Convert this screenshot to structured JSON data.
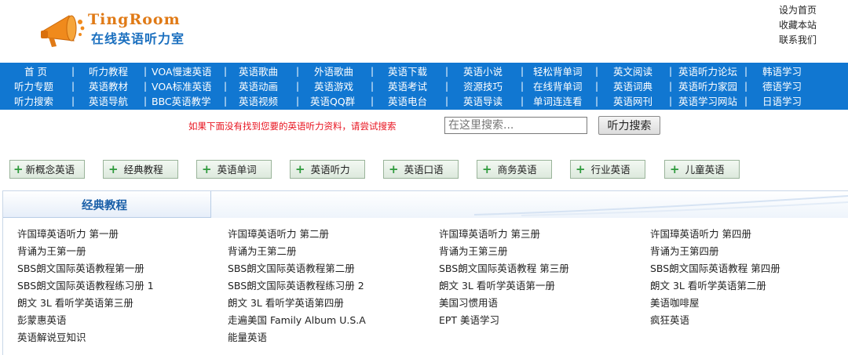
{
  "site": {
    "brand_en": "TingRoom",
    "brand_cn": "在线英语听力室",
    "top_links": [
      "设为首页",
      "收藏本站",
      "联系我们"
    ]
  },
  "nav": {
    "rows": [
      [
        "首 页",
        "听力教程",
        "VOA慢速英语",
        "英语歌曲",
        "外语歌曲",
        "英语下载",
        "英语小说",
        "轻松背单词",
        "英文阅读",
        "英语听力论坛",
        "韩语学习"
      ],
      [
        "听力专题",
        "英语教材",
        "VOA标准英语",
        "英语动画",
        "英语游戏",
        "英语考试",
        "资源技巧",
        "在线背单词",
        "英语词典",
        "英语听力家园",
        "德语学习"
      ],
      [
        "听力搜索",
        "英语导航",
        "BBC英语教学",
        "英语视频",
        "英语QQ群",
        "英语电台",
        "英语导读",
        "单词连连看",
        "英语网刊",
        "英语学习网站",
        "日语学习"
      ]
    ]
  },
  "search": {
    "hint": "如果下面没有找到您要的英语听力资料，请尝试搜索",
    "placeholder": "在这里搜索...",
    "button": "听力搜索"
  },
  "categories": [
    "新概念英语",
    "经典教程",
    "英语单词",
    "英语听力",
    "英语口语",
    "商务英语",
    "行业英语",
    "儿童英语"
  ],
  "panel": {
    "title": "经典教程",
    "courses": [
      [
        "许国璋英语听力 第一册",
        "许国璋英语听力 第二册",
        "许国璋英语听力 第三册",
        "许国璋英语听力 第四册"
      ],
      [
        "背诵为王第一册",
        "背诵为王第二册",
        "背诵为王第三册",
        "背诵为王第四册"
      ],
      [
        "SBS朗文国际英语教程第一册",
        "SBS朗文国际英语教程第二册",
        "SBS朗文国际英语教程 第三册",
        "SBS朗文国际英语教程 第四册"
      ],
      [
        "SBS朗文国际英语教程练习册 1",
        "SBS朗文国际英语教程练习册 2",
        "朗文 3L 看听学英语第一册",
        "朗文 3L 看听学英语第二册"
      ],
      [
        "朗文 3L 看听学英语第三册",
        "朗文 3L 看听学英语第四册",
        "美国习惯用语",
        "美语咖啡屋"
      ],
      [
        "彭蒙惠英语",
        "走遍美国 Family Album U.S.A",
        "EPT 美语学习",
        "疯狂英语"
      ],
      [
        "英语解说豆知识",
        "能量英语"
      ]
    ]
  },
  "colors": {
    "nav_bg": "#1177d1",
    "hint_red": "#e8131f",
    "panel_title": "#1a5fa8",
    "brand_orange": "#e07a16",
    "brand_blue": "#1a6fbf"
  }
}
